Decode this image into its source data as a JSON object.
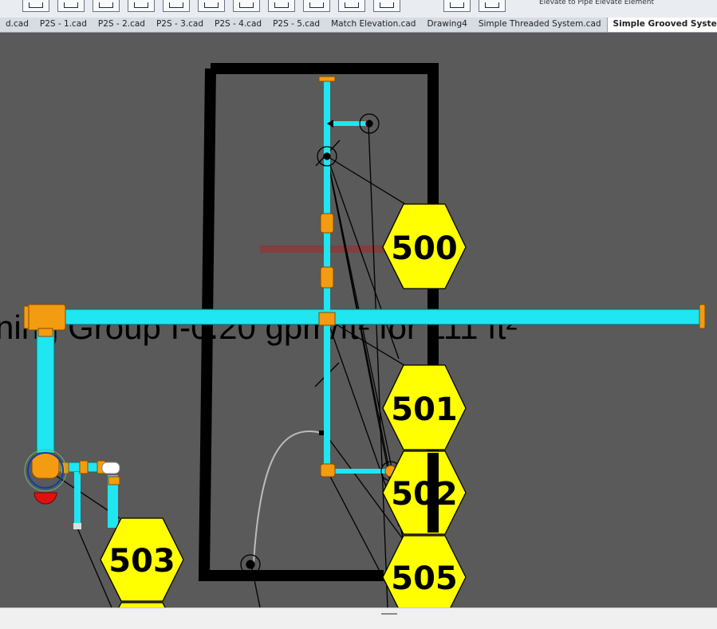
{
  "tabs": [
    {
      "label": "d.cad",
      "active": false
    },
    {
      "label": "P2S - 1.cad",
      "active": false
    },
    {
      "label": "P2S - 2.cad",
      "active": false
    },
    {
      "label": "P2S - 3.cad",
      "active": false
    },
    {
      "label": "P2S - 4.cad",
      "active": false
    },
    {
      "label": "P2S - 5.cad",
      "active": false
    },
    {
      "label": "Match Elevation.cad",
      "active": false
    },
    {
      "label": "Drawing4",
      "active": false
    },
    {
      "label": "Simple Threaded System.cad",
      "active": false
    },
    {
      "label": "Simple Grooved System.cad",
      "active": true
    }
  ],
  "tab_close_glyph": "×",
  "ribbon": {
    "partial_text": "Elevate to Pipe   Elevate Element"
  },
  "drawing": {
    "design_text": "ning Group I-0.20 gpm/ft² for 111 ft²",
    "labels": [
      "500",
      "501",
      "502",
      "505",
      "503"
    ]
  },
  "colors": {
    "pipe": "#1fe6f0",
    "fitting": "#f39c12",
    "label_fill": "#ffff00",
    "wall": "#000000",
    "background": "#5a5a5a"
  }
}
